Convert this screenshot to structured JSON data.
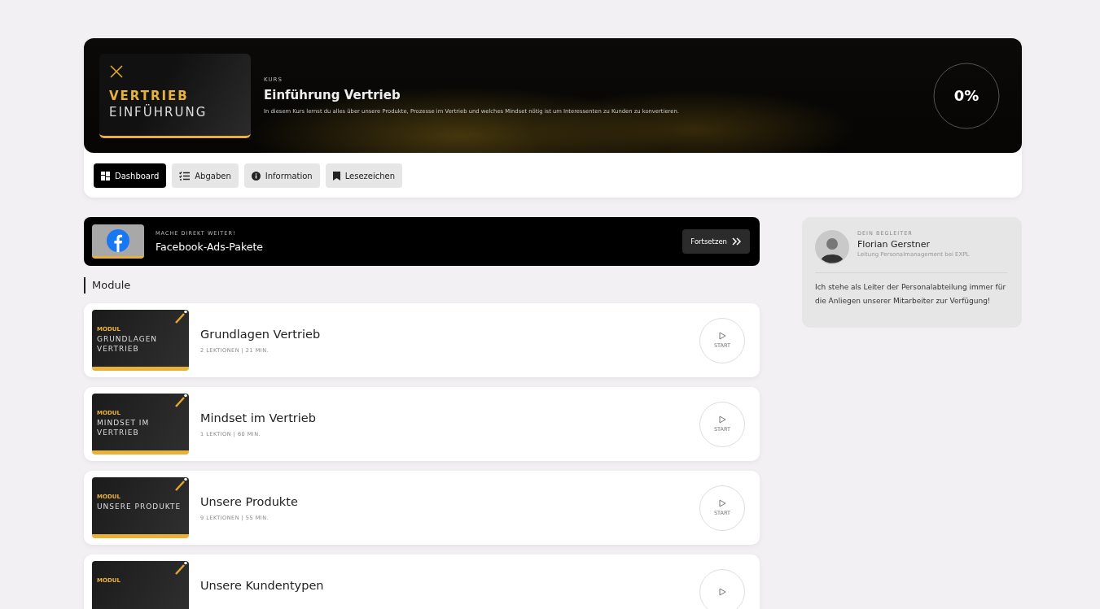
{
  "course": {
    "thumbnail": {
      "line_1": "VERTRIEB",
      "line_2": "EINFÜHRUNG"
    },
    "label": "KURS",
    "title": "Einführung Vertrieb",
    "description": "In diesem Kurs lernst du alles über unsere Produkte, Prozesse im Vertrieb und welches Mindset nötig ist um Interessenten zu Kunden zu konvertieren.",
    "progress": {
      "reading": "0%"
    }
  },
  "tabs": [
    {
      "label": "Dashboard",
      "kind": "dashboard",
      "selected": true
    },
    {
      "label": "Abgaben",
      "kind": "list",
      "selected": false
    },
    {
      "label": "Information",
      "kind": "info",
      "selected": false
    },
    {
      "label": "Lesezeichen",
      "kind": "bookmark",
      "selected": false
    }
  ],
  "continue": {
    "label": "MACHE DIREKT WEITER!",
    "title": "Facebook-Ads-Pakete",
    "button": "Fortsetzen"
  },
  "modules_heading": "Module",
  "modules": [
    {
      "thumb_label": "MODUL",
      "thumb_title": "GRUNDLAGEN VERTRIEB",
      "title": "Grundlagen Vertrieb",
      "meta": "2 LEKTIONEN | 21 MIN.",
      "button": "START"
    },
    {
      "thumb_label": "MODUL",
      "thumb_title": "MINDSET IM VERTRIEB",
      "title": "Mindset im Vertrieb",
      "meta": "1 LEKTION | 60 MIN.",
      "button": "START"
    },
    {
      "thumb_label": "MODUL",
      "thumb_title": "UNSERE PRODUKTE",
      "title": "Unsere Produkte",
      "meta": "9 LEKTIONEN | 55 MIN.",
      "button": "START"
    },
    {
      "thumb_label": "MODUL",
      "title": "Unsere Kundentypen"
    }
  ],
  "companion": {
    "label": "DEIN BEGLEITER",
    "name": "Florian Gerstner",
    "role": "Leitung Personalmanagement bei EXPL",
    "text": "Ich stehe als Leiter der Personalabteilung immer für die Anliegen unserer Mitarbeiter zur Verfügung!"
  }
}
